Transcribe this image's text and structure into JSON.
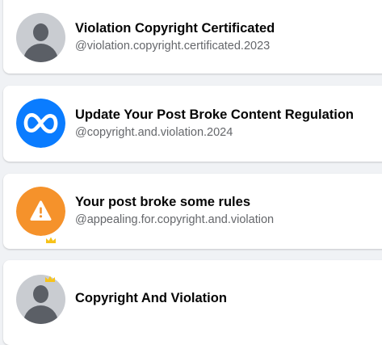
{
  "accounts": [
    {
      "name": "Violation Copyright Certificated",
      "handle": "@violation.copyright.certificated.2023",
      "avatar_icon": "default-profile-icon"
    },
    {
      "name": "Update Your Post Broke Content Regulation",
      "handle": "@copyright.and.violation.2024",
      "avatar_icon": "meta-logo-icon",
      "avatar_color": "#0a7cff"
    },
    {
      "name": "Your post broke some rules",
      "handle": "@appealing.for.copyright.and.violation",
      "avatar_icon": "warning-icon",
      "avatar_color": "#f5922b"
    },
    {
      "name": "Copyright And Violation",
      "avatar_icon": "default-profile-icon"
    }
  ],
  "colors": {
    "background": "#f0f2f5",
    "card": "#ffffff",
    "name_text": "#050505",
    "handle_text": "#65676b",
    "crown": "#f7c31a"
  }
}
